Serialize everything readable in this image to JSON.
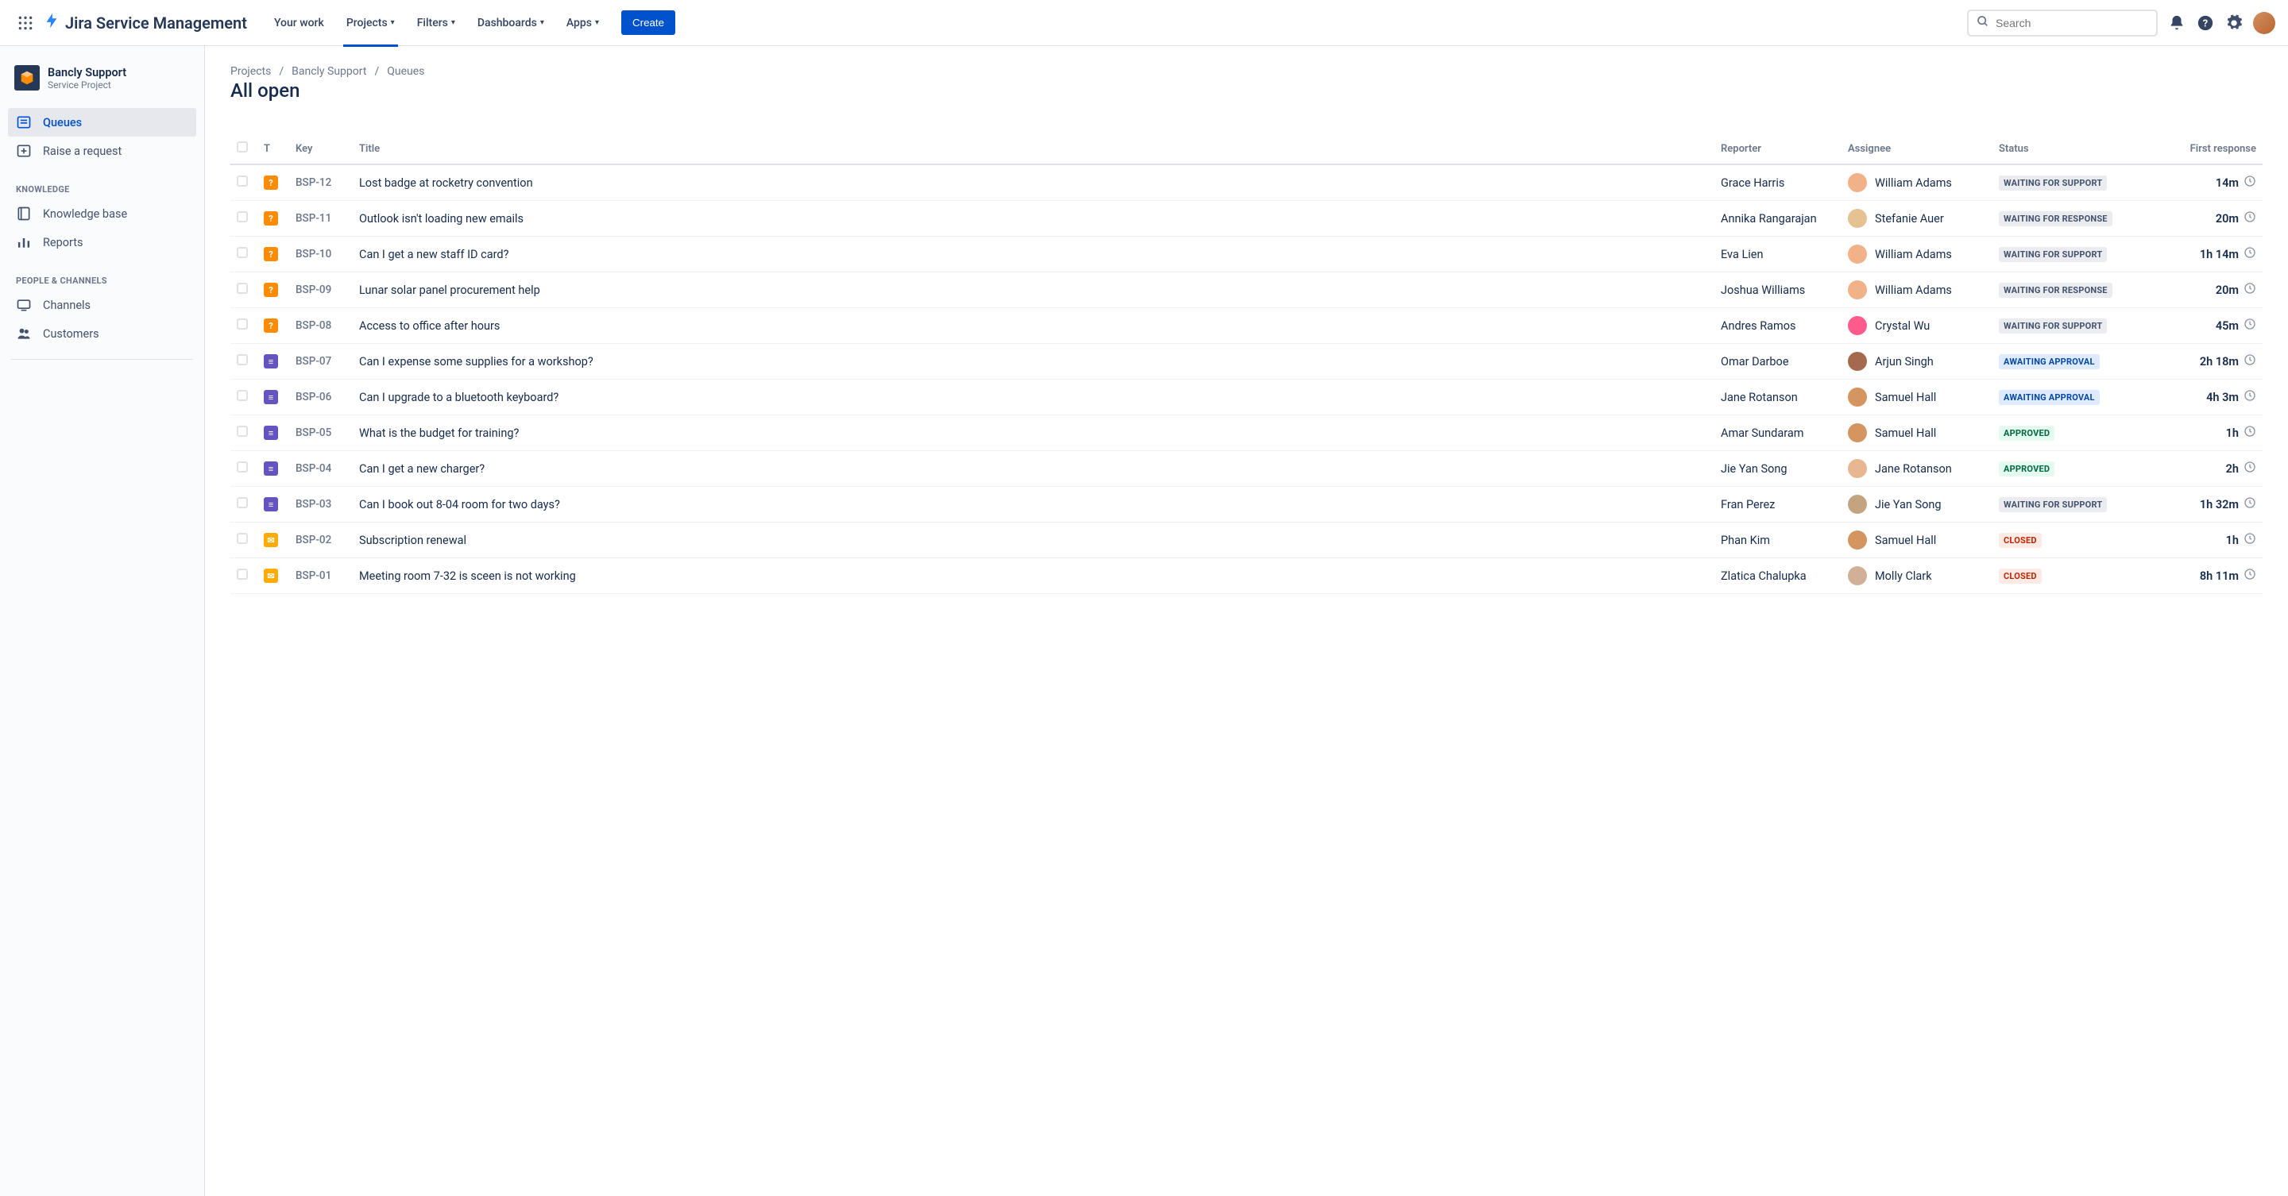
{
  "header": {
    "product": "Jira Service Management",
    "nav": [
      "Your work",
      "Projects",
      "Filters",
      "Dashboards",
      "Apps"
    ],
    "nav_dropdowns": [
      false,
      true,
      true,
      true,
      true
    ],
    "nav_active_index": 1,
    "create": "Create",
    "search_placeholder": "Search"
  },
  "sidebar": {
    "project_name": "Bancly Support",
    "project_type": "Service Project",
    "main_items": [
      {
        "label": "Queues",
        "icon": "queue-icon",
        "active": true
      },
      {
        "label": "Raise a request",
        "icon": "raise-request-icon",
        "active": false
      }
    ],
    "groups": [
      {
        "label": "KNOWLEDGE",
        "items": [
          {
            "label": "Knowledge base",
            "icon": "book-icon"
          },
          {
            "label": "Reports",
            "icon": "reports-icon"
          }
        ]
      },
      {
        "label": "PEOPLE & CHANNELS",
        "items": [
          {
            "label": "Channels",
            "icon": "channels-icon"
          },
          {
            "label": "Customers",
            "icon": "customers-icon"
          }
        ]
      }
    ]
  },
  "breadcrumb": [
    "Projects",
    "Bancly Support",
    "Queues"
  ],
  "page_title": "All open",
  "columns": {
    "t": "T",
    "key": "Key",
    "title": "Title",
    "reporter": "Reporter",
    "assignee": "Assignee",
    "status": "Status",
    "first_response": "First response"
  },
  "rows": [
    {
      "type": "orange",
      "glyph": "?",
      "key": "BSP-12",
      "title": "Lost badge at rocketry convention",
      "reporter": "Grace Harris",
      "assignee": "William Adams",
      "av": "a-wa",
      "status": "WAITING FOR SUPPORT",
      "status_class": "status-gray",
      "resp": "14m"
    },
    {
      "type": "orange",
      "glyph": "?",
      "key": "BSP-11",
      "title": "Outlook isn't loading new emails",
      "reporter": "Annika Rangarajan",
      "assignee": "Stefanie Auer",
      "av": "a-sa",
      "status": "WAITING FOR RESPONSE",
      "status_class": "status-gray",
      "resp": "20m"
    },
    {
      "type": "orange",
      "glyph": "?",
      "key": "BSP-10",
      "title": "Can I get a new staff ID card?",
      "reporter": "Eva Lien",
      "assignee": "William Adams",
      "av": "a-wa",
      "status": "WAITING FOR SUPPORT",
      "status_class": "status-gray",
      "resp": "1h 14m"
    },
    {
      "type": "orange",
      "glyph": "?",
      "key": "BSP-09",
      "title": "Lunar solar panel procurement help",
      "reporter": "Joshua Williams",
      "assignee": "William Adams",
      "av": "a-wa",
      "status": "WAITING FOR RESPONSE",
      "status_class": "status-gray",
      "resp": "20m"
    },
    {
      "type": "orange",
      "glyph": "?",
      "key": "BSP-08",
      "title": "Access to office after hours",
      "reporter": "Andres Ramos",
      "assignee": "Crystal Wu",
      "av": "a-cw",
      "status": "WAITING FOR SUPPORT",
      "status_class": "status-gray",
      "resp": "45m"
    },
    {
      "type": "purple",
      "glyph": "≡",
      "key": "BSP-07",
      "title": "Can I expense some supplies for a workshop?",
      "reporter": "Omar Darboe",
      "assignee": "Arjun Singh",
      "av": "a-as",
      "status": "AWAITING APPROVAL",
      "status_class": "status-blue",
      "resp": "2h 18m"
    },
    {
      "type": "purple",
      "glyph": "≡",
      "key": "BSP-06",
      "title": "Can I upgrade to a bluetooth keyboard?",
      "reporter": "Jane Rotanson",
      "assignee": "Samuel Hall",
      "av": "a-sh",
      "status": "AWAITING APPROVAL",
      "status_class": "status-blue",
      "resp": "4h 3m"
    },
    {
      "type": "purple",
      "glyph": "≡",
      "key": "BSP-05",
      "title": "What is the budget for training?",
      "reporter": "Amar Sundaram",
      "assignee": "Samuel Hall",
      "av": "a-sh",
      "status": "APPROVED",
      "status_class": "status-green",
      "resp": "1h"
    },
    {
      "type": "purple",
      "glyph": "≡",
      "key": "BSP-04",
      "title": "Can I get a new charger?",
      "reporter": "Jie Yan Song",
      "assignee": "Jane Rotanson",
      "av": "a-jr",
      "status": "APPROVED",
      "status_class": "status-green",
      "resp": "2h"
    },
    {
      "type": "purple",
      "glyph": "≡",
      "key": "BSP-03",
      "title": "Can I book out 8-04 room for two days?",
      "reporter": "Fran Perez",
      "assignee": "Jie Yan Song",
      "av": "a-jy",
      "status": "WAITING FOR SUPPORT",
      "status_class": "status-gray",
      "resp": "1h 32m"
    },
    {
      "type": "yellow",
      "glyph": "✉",
      "key": "BSP-02",
      "title": "Subscription renewal",
      "reporter": "Phan Kim",
      "assignee": "Samuel Hall",
      "av": "a-sh",
      "status": "CLOSED",
      "status_class": "status-red",
      "resp": "1h"
    },
    {
      "type": "yellow",
      "glyph": "✉",
      "key": "BSP-01",
      "title": "Meeting room 7-32 is sceen is not working",
      "reporter": "Zlatica Chalupka",
      "assignee": "Molly Clark",
      "av": "a-mc",
      "status": "CLOSED",
      "status_class": "status-red",
      "resp": "8h 11m"
    }
  ]
}
